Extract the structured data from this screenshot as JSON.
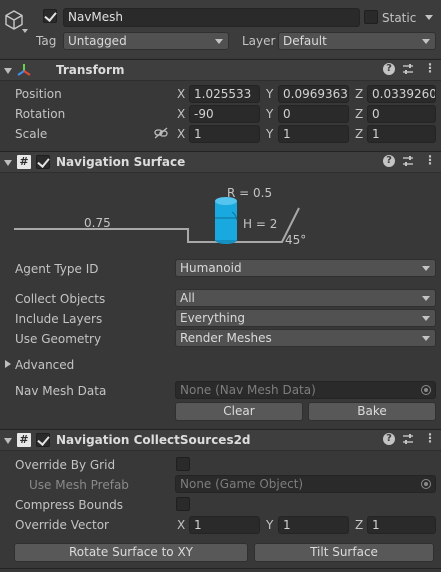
{
  "gameobject": {
    "active": true,
    "name": "NavMesh",
    "static_label": "Static",
    "static": false,
    "tag_label": "Tag",
    "tag_value": "Untagged",
    "layer_label": "Layer",
    "layer_value": "Default"
  },
  "transform": {
    "title": "Transform",
    "position_label": "Position",
    "rotation_label": "Rotation",
    "scale_label": "Scale",
    "axis_x": "X",
    "axis_y": "Y",
    "axis_z": "Z",
    "position": {
      "x": "1.025533",
      "y": "0.0969363",
      "z": "0.0339260"
    },
    "rotation": {
      "x": "-90",
      "y": "0",
      "z": "0"
    },
    "scale": {
      "x": "1",
      "y": "1",
      "z": "1"
    }
  },
  "nav_surface": {
    "title": "Navigation Surface",
    "enabled": true,
    "diagram": {
      "radius_label": "R = 0.5",
      "height_label": "H = 2",
      "step_label": "0.75",
      "slope_label": "45°"
    },
    "agent_type_label": "Agent Type ID",
    "agent_type_value": "Humanoid",
    "collect_objects_label": "Collect Objects",
    "collect_objects_value": "All",
    "include_layers_label": "Include Layers",
    "include_layers_value": "Everything",
    "use_geometry_label": "Use Geometry",
    "use_geometry_value": "Render Meshes",
    "advanced_label": "Advanced",
    "nav_mesh_data_label": "Nav Mesh Data",
    "nav_mesh_data_value": "None (Nav Mesh Data)",
    "clear_label": "Clear",
    "bake_label": "Bake"
  },
  "collect_sources": {
    "title": "Navigation CollectSources2d",
    "enabled": true,
    "override_by_grid_label": "Override By Grid",
    "override_by_grid": false,
    "use_mesh_prefab_label": "Use Mesh Prefab",
    "use_mesh_prefab_value": "None (Game Object)",
    "compress_bounds_label": "Compress Bounds",
    "compress_bounds": false,
    "override_vector_label": "Override Vector",
    "override_vector": {
      "x": "1",
      "y": "1",
      "z": "1"
    },
    "rotate_button_label": "Rotate Surface to XY",
    "tilt_button_label": "Tilt Surface"
  },
  "colors": {
    "background": "#383838",
    "header": "#3e3e3e",
    "field": "#2a2a2a",
    "agent_cylinder": "#1aa9de"
  }
}
